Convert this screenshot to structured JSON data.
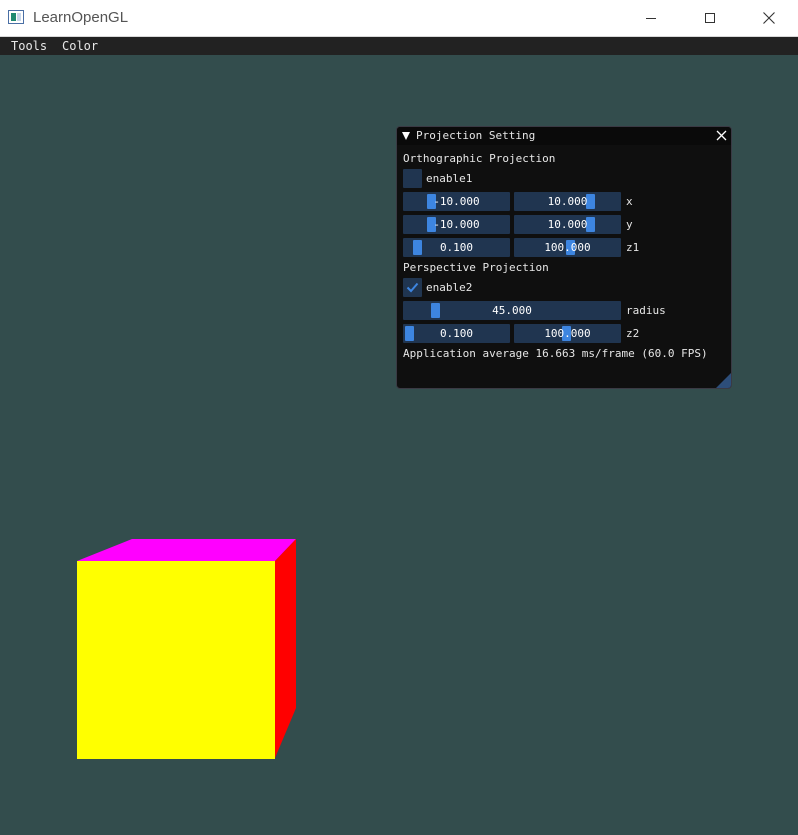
{
  "window": {
    "title": "LearnOpenGL",
    "icon": "opengl-app-icon",
    "controls": [
      "minimize-icon",
      "maximize-icon",
      "close-icon"
    ]
  },
  "menubar": {
    "tools": "Tools",
    "color": "Color"
  },
  "scene": {
    "background_color": "#334d4d",
    "cube": {
      "front_color": "#ffff00",
      "top_color": "#ff00ff",
      "side_color": "#ff0000"
    }
  },
  "panel": {
    "title": "Projection Setting",
    "orthographic": {
      "header": "Orthographic Projection",
      "enable_label": "enable1",
      "enabled": false,
      "x": {
        "label": "x",
        "min": "-10.000",
        "max": "10.000"
      },
      "y": {
        "label": "y",
        "min": "-10.000",
        "max": "10.000"
      },
      "z": {
        "label": "z1",
        "near": "0.100",
        "far": "100.000"
      }
    },
    "perspective": {
      "header": "Perspective Projection",
      "enable_label": "enable2",
      "enabled": true,
      "radius": {
        "label": "radius",
        "value": "45.000"
      },
      "z": {
        "label": "z2",
        "near": "0.100",
        "far": "100.000"
      }
    },
    "fps_text": "Application average 16.663 ms/frame (60.0 FPS)"
  },
  "colors": {
    "frame_bg": "#203550",
    "slider_grab": "#3d85e0",
    "check_mark": "#3d85e0",
    "panel_bg": "#0f0f0f"
  }
}
